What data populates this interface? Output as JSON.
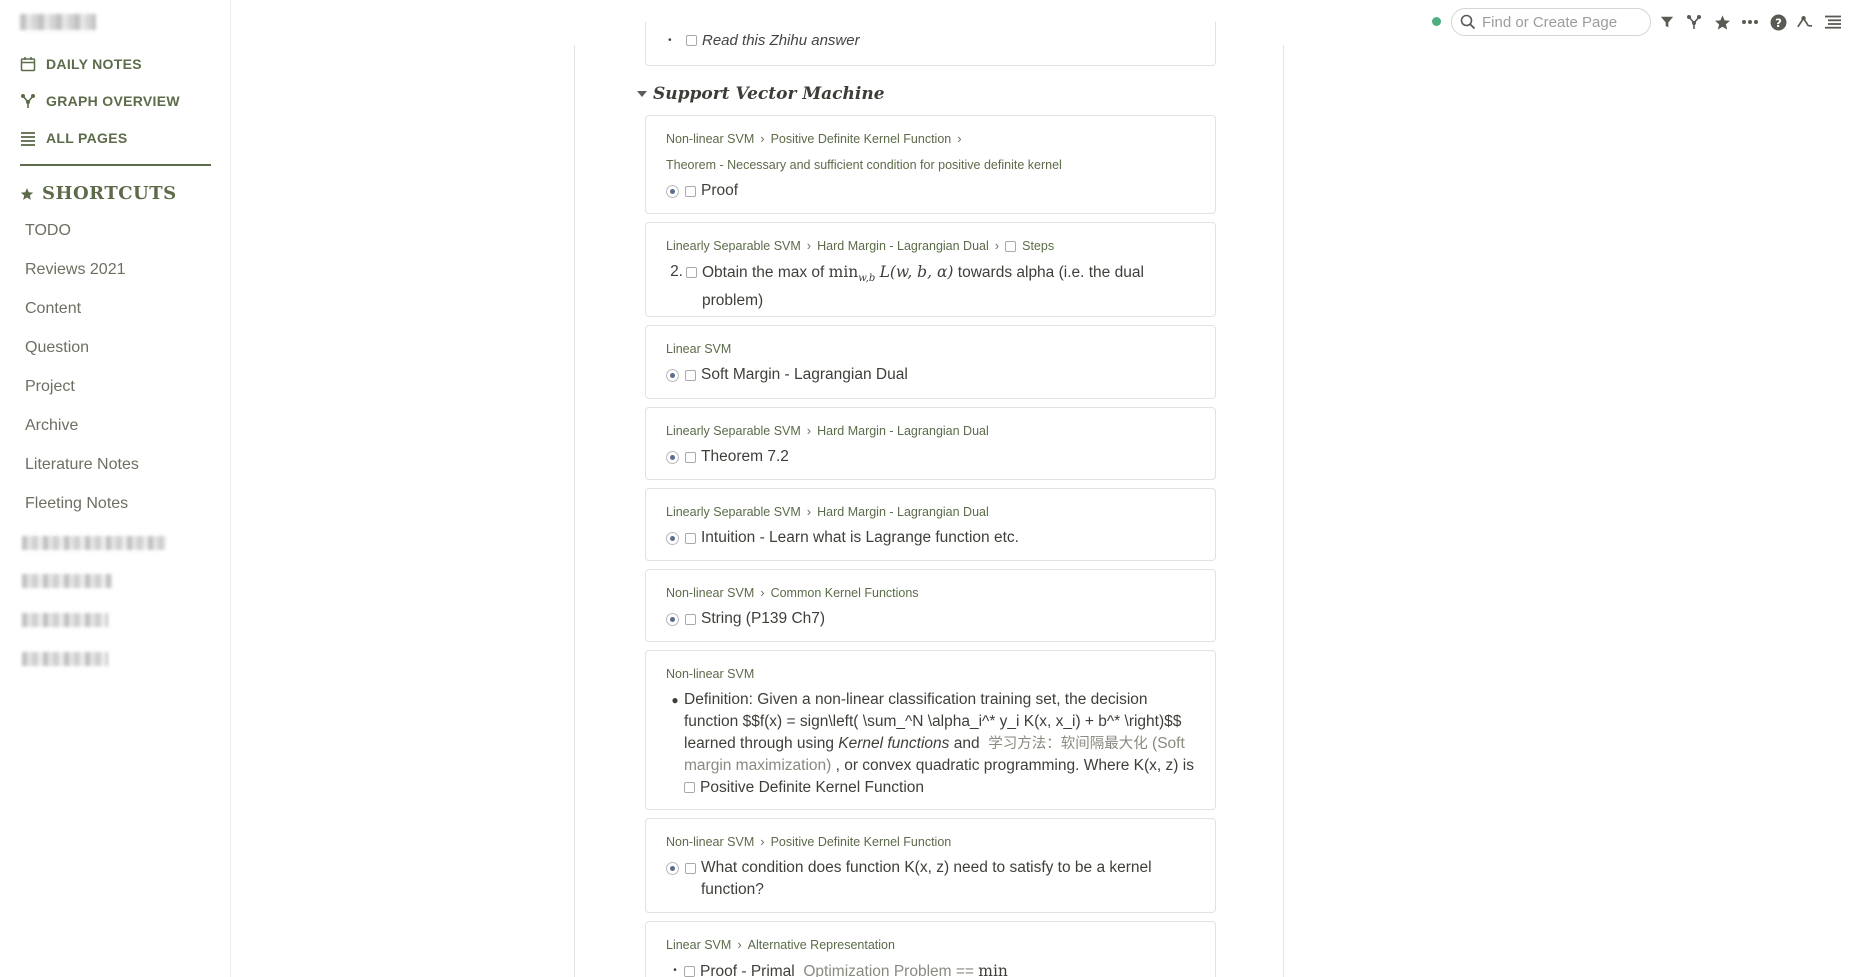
{
  "sidebar": {
    "nav": [
      {
        "label": "DAILY NOTES",
        "icon": "calendar-icon"
      },
      {
        "label": "GRAPH OVERVIEW",
        "icon": "graph-icon"
      },
      {
        "label": "ALL PAGES",
        "icon": "list-icon"
      }
    ],
    "shortcuts_title": "SHORTCUTS",
    "shortcuts": [
      "TODO",
      "Reviews 2021",
      "Content",
      "Question",
      "Project",
      "Archive",
      "Literature Notes",
      "Fleeting Notes"
    ]
  },
  "topbar": {
    "search_placeholder": "Find or Create Page",
    "icons": [
      "filter-icon",
      "branch-icon",
      "star-icon",
      "more-icon",
      "help-icon",
      "graph-settings-icon",
      "menu-icon"
    ]
  },
  "main": {
    "top_card_text": "Read this Zhihu answer",
    "section_title": "Support Vector Machine",
    "cards": [
      {
        "crumbs": [
          "Non-linear SVM",
          "Positive Definite Kernel Function",
          "Theorem - Necessary and sufficient condition for positive definite kernel"
        ],
        "text": "Proof"
      },
      {
        "crumbs": [
          "Linearly Separable SVM",
          "Hard Margin - Lagrangian Dual",
          "Steps"
        ],
        "num": "2.",
        "text_a": "Obtain the max of",
        "math": "min",
        "math_sub": "w,b",
        "math_b": "L(w, b, α)",
        "text_b": "towards alpha (i.e. the dual problem)"
      },
      {
        "crumbs": [
          "Linear SVM"
        ],
        "text": "Soft Margin - Lagrangian Dual"
      },
      {
        "crumbs": [
          "Linearly Separable SVM",
          "Hard Margin - Lagrangian Dual"
        ],
        "text": "Theorem 7.2"
      },
      {
        "crumbs": [
          "Linearly Separable SVM",
          "Hard Margin - Lagrangian Dual"
        ],
        "text": "Intuition - Learn what is Lagrange function etc."
      },
      {
        "crumbs": [
          "Non-linear SVM",
          "Common Kernel Functions"
        ],
        "text": "String (P139 Ch7)"
      },
      {
        "crumbs": [
          "Non-linear SVM"
        ],
        "def_a": "Definition: Given a non-linear classification training set, the decision function $$f(x) = sign\\left( \\sum_^N \\alpha_i^* y_i K(x, x_i) + b^* \\right)$$ learned through using",
        "def_kernel": "Kernel functions",
        "def_and": "and",
        "def_zh": "学习方法：软间隔最大化",
        "def_paren": "(Soft margin maximization)",
        "def_b": ", or convex quadratic programming. Where K(x, z) is",
        "def_link": "Positive Definite Kernel Function"
      },
      {
        "crumbs": [
          "Non-linear SVM",
          "Positive Definite Kernel Function"
        ],
        "text": "What condition does function K(x, z) need to satisfy to be a kernel function?"
      },
      {
        "crumbs": [
          "Linear SVM",
          "Alternative Representation"
        ],
        "text": "Proof - Primal",
        "text_b": "Optimization Problem ==",
        "math": "min"
      }
    ]
  }
}
